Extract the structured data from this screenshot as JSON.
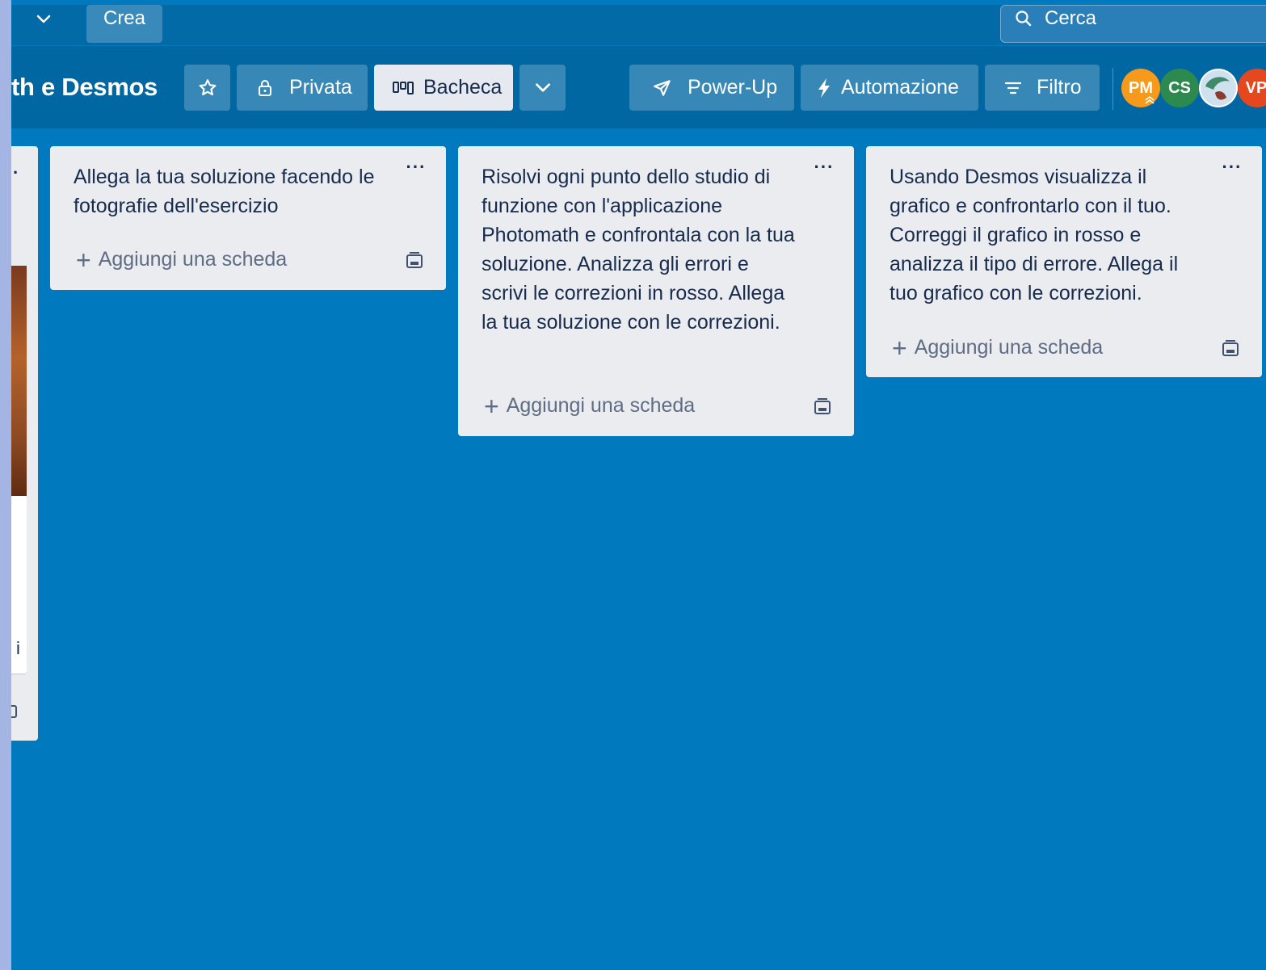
{
  "topbar": {
    "create_label": "Crea",
    "search_placeholder": "Cerca"
  },
  "board": {
    "title": "th e Desmos",
    "visibility_label": "Privata",
    "view_label": "Bacheca",
    "powerup_label": "Power-Up",
    "automation_label": "Automazione",
    "filter_label": "Filtro",
    "members": [
      {
        "initials": "PM",
        "color": "#f79a1b"
      },
      {
        "initials": "CS",
        "color": "#2d8a4e"
      },
      {
        "initials": "",
        "color": "#8fb7d6"
      },
      {
        "initials": "VP",
        "color": "#e5481f"
      }
    ]
  },
  "lists": [
    {
      "title": "Allega la tua soluzione facendo le fotografie dell'esercizio",
      "add_card_label": "Aggiungi una scheda",
      "menu_label": "···"
    },
    {
      "title": "Risolvi ogni punto dello studio di funzione con l'applicazione Photomath e confrontala con la tua soluzione. Analizza gli errori e scrivi le correzioni in rosso. Allega la tua soluzione con le correzioni.",
      "add_card_label": "Aggiungi una scheda",
      "menu_label": "···"
    },
    {
      "title": "Usando Desmos visualizza il grafico e confrontarlo con il tuo. Correggi il grafico in rosso e analizza il tipo di errore. Allega il tuo grafico con le correzioni.",
      "add_card_label": "Aggiungi una scheda",
      "menu_label": "···"
    }
  ],
  "partial": {
    "menu_dot": "·",
    "card_text": "i"
  },
  "colors": {
    "board_bg": "#0079bf",
    "topbar_bg": "#026aa7",
    "list_bg": "#ebecf0"
  }
}
